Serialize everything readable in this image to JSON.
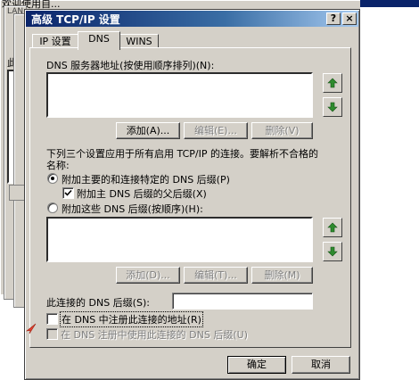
{
  "background": {
    "top_title": "欢迎使用自...",
    "mid_title": "LAN...",
    "side_letter": "此"
  },
  "dialog": {
    "title": "高级 TCP/IP 设置",
    "help_button": "?",
    "close_button": "×",
    "tabs": [
      {
        "label": "IP 设置"
      },
      {
        "label": "DNS"
      },
      {
        "label": "WINS"
      }
    ],
    "dns_servers": {
      "label": "DNS 服务器地址(按使用顺序排列)(N):",
      "add_button": "添加(A)...",
      "edit_button": "编辑(E)...",
      "delete_button": "删除(V)"
    },
    "description": "下列三个设置应用于所有启用 TCP/IP 的连接。要解析不合格的名称:",
    "description_line1": "下列三个设置应用于所有启用 TCP/IP 的连接。要解析不合格的",
    "description_line2": "名称:",
    "radio_primary": "附加主要的和连接特定的 DNS 后缀(P)",
    "check_parent": "附加主 DNS 后缀的父后缀(X)",
    "radio_these": "附加这些 DNS 后缀(按顺序)(H):",
    "suffix_add_button": "添加(D)...",
    "suffix_edit_button": "编辑(T)...",
    "suffix_delete_button": "删除(M)",
    "connection_suffix_label": "此连接的 DNS 后缀(S):",
    "connection_suffix_value": "",
    "check_register": "在 DNS 中注册此连接的地址(R)",
    "check_register_suffix": "在 DNS 注册中使用此连接的 DNS 后缀(U)",
    "ok_button": "确定",
    "cancel_button": "取消"
  },
  "colors": {
    "titlebar_start": "#0a246a",
    "titlebar_end": "#a6caf0",
    "arrow_green": "#2e8b2e",
    "face": "#d4d0c8"
  }
}
